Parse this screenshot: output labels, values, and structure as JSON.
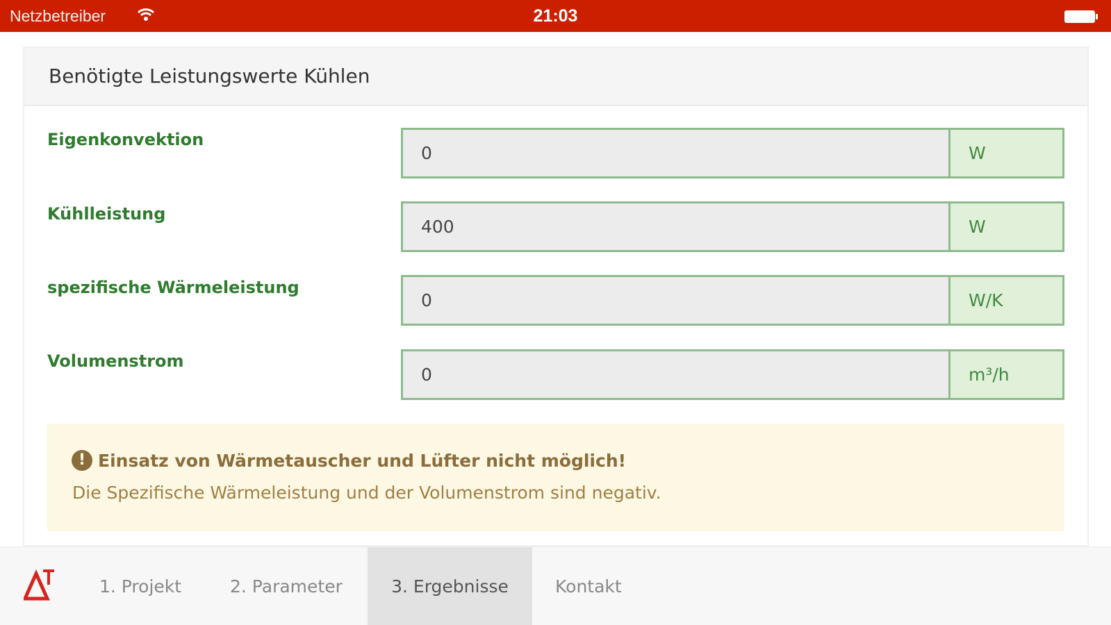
{
  "status_bar": {
    "carrier": "Netzbetreiber",
    "time": "21:03",
    "wifi_icon": "wifi-icon",
    "battery_icon": "battery-icon"
  },
  "panel": {
    "title": "Benötigte Leistungswerte Kühlen",
    "rows": [
      {
        "label": "Eigenkonvektion",
        "value": "0",
        "unit": "W"
      },
      {
        "label": "Kühlleistung",
        "value": "400",
        "unit": "W"
      },
      {
        "label": "spezifische Wärmeleistung",
        "value": "0",
        "unit": "W/K"
      },
      {
        "label": "Volumenstrom",
        "value": "0",
        "unit": "m³/h"
      }
    ]
  },
  "alert": {
    "icon": "exclamation-circle-icon",
    "title": "Einsatz von Wärmetauscher und Lüfter nicht möglich!",
    "text": "Die Spezifische Wärmeleistung und der Volumenstrom sind negativ."
  },
  "tabbar": {
    "logo_icon": "delta-t-logo-icon",
    "tabs": [
      {
        "label": "1. Projekt",
        "active": false
      },
      {
        "label": "2. Parameter",
        "active": false
      },
      {
        "label": "3. Ergebnisse",
        "active": true
      },
      {
        "label": "Kontakt",
        "active": false
      }
    ]
  },
  "colors": {
    "status_bar": "#cc1f00",
    "label_green": "#2f7b2f",
    "field_border": "#8dbb8d",
    "unit_bg": "#e0f0d9",
    "alert_bg": "#fcf8e3",
    "alert_text": "#8a6d3b"
  }
}
